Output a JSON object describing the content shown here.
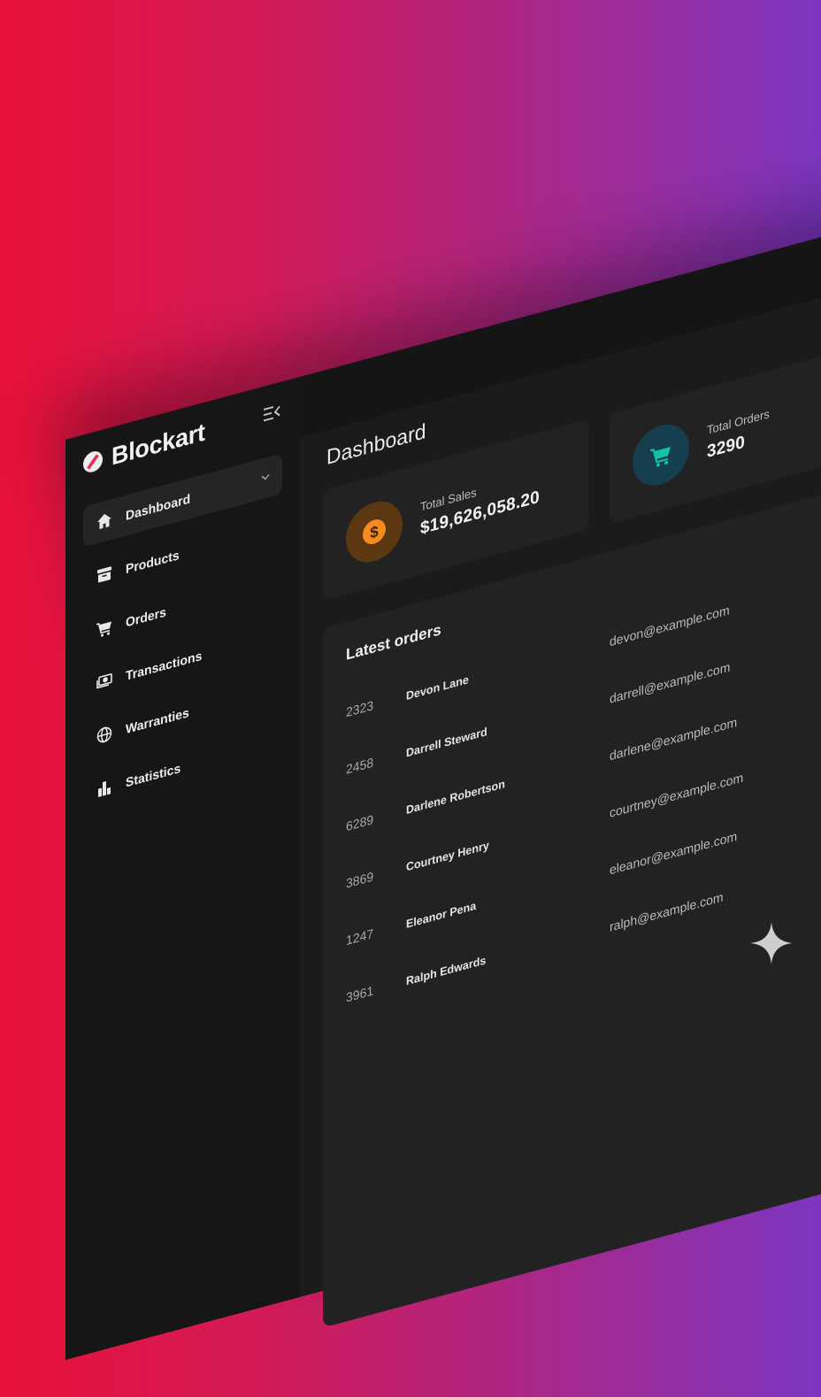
{
  "app": {
    "brand": "Blockart"
  },
  "sidebar": {
    "items": [
      {
        "label": "Dashboard",
        "icon": "home-icon"
      },
      {
        "label": "Products",
        "icon": "archive-box-icon"
      },
      {
        "label": "Orders",
        "icon": "cart-icon"
      },
      {
        "label": "Transactions",
        "icon": "money-icon"
      },
      {
        "label": "Warranties",
        "icon": "globe-icon"
      },
      {
        "label": "Statistics",
        "icon": "bar-chart-icon"
      }
    ]
  },
  "main": {
    "title": "Dashboard",
    "stats": {
      "sales": {
        "label": "Total Sales",
        "value": "$19,626,058.20",
        "icon": "dollar-coin-icon",
        "color": "#f58a1f"
      },
      "orders": {
        "label": "Total Orders",
        "value": "3290",
        "icon": "shopping-cart-icon",
        "color": "#14c1a7"
      }
    },
    "latest_orders": {
      "title": "Latest orders",
      "rows": [
        {
          "id": "2323",
          "name": "Devon Lane",
          "email": "devon@example.com"
        },
        {
          "id": "2458",
          "name": "Darrell Steward",
          "email": "darrell@example.com"
        },
        {
          "id": "6289",
          "name": "Darlene Robertson",
          "email": "darlene@example.com"
        },
        {
          "id": "3869",
          "name": "Courtney Henry",
          "email": "courtney@example.com"
        },
        {
          "id": "1247",
          "name": "Eleanor Pena",
          "email": "eleanor@example.com"
        },
        {
          "id": "3961",
          "name": "Ralph Edwards",
          "email": "ralph@example.com"
        }
      ]
    }
  },
  "colors": {
    "accent_orange": "#f58a1f",
    "accent_teal": "#14c1a7",
    "background_start": "#e8113a",
    "background_end": "#7d36c2"
  }
}
